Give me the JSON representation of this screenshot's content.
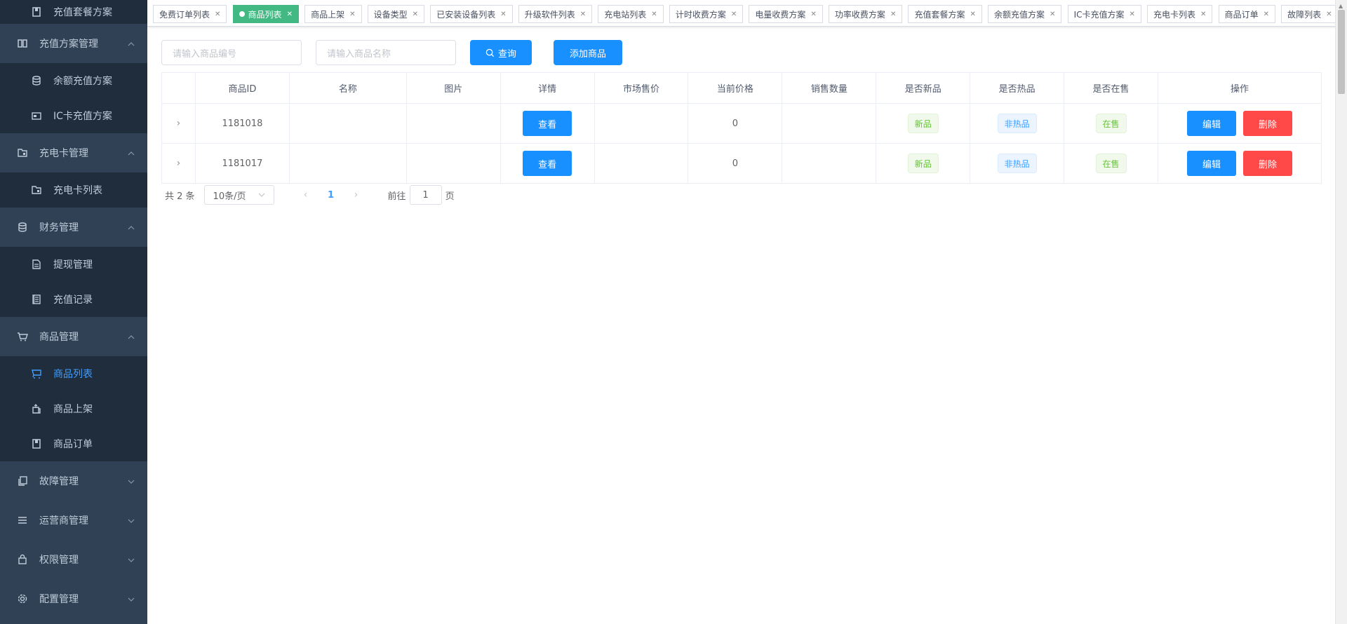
{
  "sidebar": {
    "items": [
      {
        "label": "充值套餐方案",
        "icon": "package-icon",
        "type": "sub"
      },
      {
        "label": "充值方案管理",
        "icon": "book-icon",
        "type": "group",
        "arrow": "up"
      },
      {
        "label": "余额充值方案",
        "icon": "coins-icon",
        "type": "sub"
      },
      {
        "label": "IC卡充值方案",
        "icon": "card-icon",
        "type": "sub"
      },
      {
        "label": "充电卡管理",
        "icon": "folder-card-icon",
        "type": "group",
        "arrow": "up"
      },
      {
        "label": "充电卡列表",
        "icon": "folder-card-icon",
        "type": "sub"
      },
      {
        "label": "财务管理",
        "icon": "database-icon",
        "type": "group",
        "arrow": "up"
      },
      {
        "label": "提现管理",
        "icon": "document-icon",
        "type": "sub"
      },
      {
        "label": "充值记录",
        "icon": "ledger-icon",
        "type": "sub"
      },
      {
        "label": "商品管理",
        "icon": "cart-icon",
        "type": "group",
        "arrow": "up"
      },
      {
        "label": "商品列表",
        "icon": "cart-icon",
        "type": "sub",
        "active": true
      },
      {
        "label": "商品上架",
        "icon": "shelf-icon",
        "type": "sub"
      },
      {
        "label": "商品订单",
        "icon": "order-icon",
        "type": "sub"
      },
      {
        "label": "故障管理",
        "icon": "copy-icon",
        "type": "group",
        "arrow": "down"
      },
      {
        "label": "运营商管理",
        "icon": "list-icon",
        "type": "group",
        "arrow": "down"
      },
      {
        "label": "权限管理",
        "icon": "bag-icon",
        "type": "group",
        "arrow": "down"
      },
      {
        "label": "配置管理",
        "icon": "gear-icon",
        "type": "group",
        "arrow": "down"
      }
    ]
  },
  "tags": [
    {
      "label": "免费订单列表"
    },
    {
      "label": "商品列表",
      "active": true
    },
    {
      "label": "商品上架"
    },
    {
      "label": "设备类型"
    },
    {
      "label": "已安装设备列表"
    },
    {
      "label": "升级软件列表"
    },
    {
      "label": "充电站列表"
    },
    {
      "label": "计时收费方案"
    },
    {
      "label": "电量收费方案"
    },
    {
      "label": "功率收费方案"
    },
    {
      "label": "充值套餐方案"
    },
    {
      "label": "余额充值方案"
    },
    {
      "label": "IC卡充值方案"
    },
    {
      "label": "充电卡列表"
    },
    {
      "label": "商品订单"
    },
    {
      "label": "故障列表"
    }
  ],
  "filter": {
    "code_placeholder": "请输入商品编号",
    "name_placeholder": "请输入商品名称",
    "query_label": "查询",
    "add_label": "添加商品"
  },
  "table": {
    "headers": [
      "",
      "商品ID",
      "名称",
      "图片",
      "详情",
      "市场售价",
      "当前价格",
      "销售数量",
      "是否新品",
      "是否热品",
      "是否在售",
      "操作"
    ],
    "rows": [
      {
        "id": "1181018",
        "name": "",
        "image": "",
        "detail": "查看",
        "market_price": "",
        "current_price": "0",
        "sales": "",
        "is_new": "新品",
        "is_hot": "非热品",
        "on_sale": "在售",
        "edit": "编辑",
        "delete": "删除"
      },
      {
        "id": "1181017",
        "name": "",
        "image": "",
        "detail": "查看",
        "market_price": "",
        "current_price": "0",
        "sales": "",
        "is_new": "新品",
        "is_hot": "非热品",
        "on_sale": "在售",
        "edit": "编辑",
        "delete": "删除"
      }
    ]
  },
  "pager": {
    "total": "共 2 条",
    "page_size": "10条/页",
    "current_page": "1",
    "goto_label": "前往",
    "goto_value": "1",
    "page_suffix": "页"
  },
  "colors": {
    "sidebar_bg": "#304156",
    "submenu_bg": "#1f2d3d",
    "primary": "#1890ff",
    "danger": "#ff4949",
    "active_tag": "#42b983"
  }
}
